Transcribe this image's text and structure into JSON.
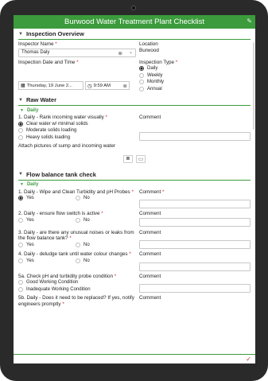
{
  "app": {
    "title": "Burwood Water Treatment Plant Checklist"
  },
  "inspection": {
    "section_title": "Inspection Overview",
    "inspector_label": "Inspector Name",
    "inspector_value": "Thomas Daly",
    "location_label": "Location",
    "location_value": "Burwood",
    "date_label": "Inspection Date and Time",
    "date_value": "Thursday, 19 June 2...",
    "time_value": "9:59 AM",
    "type_label": "Inspection Type",
    "type_options": [
      "Daily",
      "Weekly",
      "Monthly",
      "Annual"
    ],
    "type_selected": "Daily"
  },
  "raw_water": {
    "section_title": "Raw Water",
    "group_label": "Daily",
    "q1_label": "1. Daily - Rank incoming water visually",
    "q1_options": [
      "Clear water w/ minimal solids",
      "Moderate solids loading",
      "Heavy solids loading"
    ],
    "q1_selected": "Clear water w/ minimal solids",
    "comment_label": "Comment",
    "attach_label": "Attach pictures of sump and incoming water"
  },
  "flow_balance": {
    "section_title": "Flow balance tank check",
    "group_label": "Daily",
    "yes_label": "Yes",
    "no_label": "No",
    "comment_label": "Comment",
    "q1_label": "1. Daily - Wipe and Clean Turbidity and pH Probes",
    "q2_label": "2. Daily - ensure flow switch is active",
    "q3_label": "3. Daily - are there any unusual noises or leaks from the flow balance tank?",
    "q4_label": "4. Daily - deludge tank until water colour changes",
    "q5a_label": "5a. Check pH and turbidity probe condition",
    "q5a_options": [
      "Good Working Condition",
      "Inadequate Working Condition"
    ],
    "q5b_label": "5b. Daily - Does it need to be replaced? If yes, notify engineers promptly",
    "q1_selected": "Yes"
  },
  "colors": {
    "accent": "#3c9b3c",
    "required": "#d42a2a"
  }
}
